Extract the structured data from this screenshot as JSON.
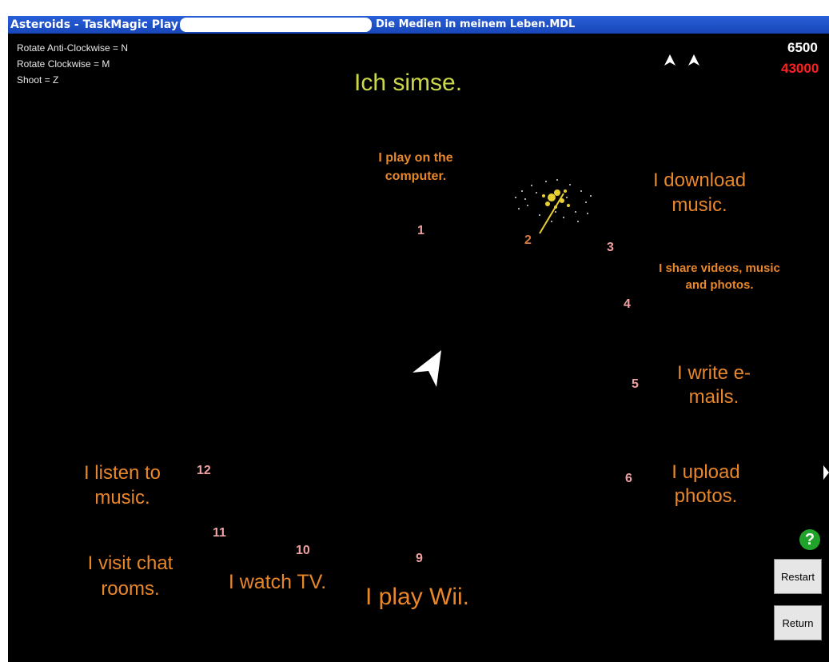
{
  "window": {
    "app_title": "Asteroids - TaskMagic Play",
    "file_title": "Die Medien in meinem Leben.MDL"
  },
  "controls": [
    "Rotate Anti-Clockwise = N",
    "Rotate Clockwise = M",
    "Shoot = Z"
  ],
  "score": "6500",
  "high_score": "43000",
  "lives": 2,
  "prompt": "Ich simse.",
  "asteroids": [
    {
      "num": "1",
      "label": "I play on the computer."
    },
    {
      "num": "2",
      "label": ""
    },
    {
      "num": "3",
      "label": "I download music."
    },
    {
      "num": "4",
      "label": "I share videos, music and photos."
    },
    {
      "num": "5",
      "label": "I write e-mails."
    },
    {
      "num": "6",
      "label": "I upload photos."
    },
    {
      "num": "9",
      "label": "I play Wii."
    },
    {
      "num": "10",
      "label": "I watch TV."
    },
    {
      "num": "11",
      "label": "I visit chat rooms."
    },
    {
      "num": "12",
      "label": "I listen to music."
    }
  ],
  "buttons": {
    "help": "?",
    "restart": "Restart",
    "return": "Return"
  },
  "colors": {
    "background": "#000000",
    "answer_text": "#e8862a",
    "number_text": "#f0a0a0",
    "prompt_text": "#ccd84a",
    "high_score": "#ff2020"
  }
}
